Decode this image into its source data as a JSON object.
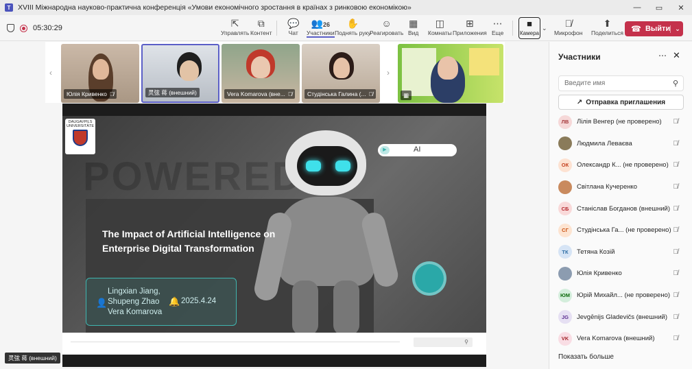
{
  "window": {
    "title": "XVIII Міжнародна науково-практична конференція «Умови економічного зростання в країнах з ринковою економікою»",
    "controls": [
      "—",
      "▭",
      "✕"
    ]
  },
  "toolbar": {
    "timer": "05:30:29",
    "buttons": [
      {
        "label": "Управлять",
        "icon": "control-icon"
      },
      {
        "label": "Контент",
        "icon": "share-content-icon"
      },
      {
        "label": "Чат",
        "icon": "chat-icon"
      },
      {
        "label": "Участники",
        "icon": "people-icon",
        "count": "26"
      },
      {
        "label": "Поднять руку",
        "icon": "raise-hand-icon"
      },
      {
        "label": "Реагировать",
        "icon": "react-icon"
      },
      {
        "label": "Вид",
        "icon": "view-icon"
      },
      {
        "label": "Комнаты",
        "icon": "rooms-icon"
      },
      {
        "label": "Приложения",
        "icon": "apps-icon"
      },
      {
        "label": "Еще",
        "icon": "more-icon"
      },
      {
        "label": "Камера",
        "icon": "camera-icon"
      },
      {
        "label": "Микрофон",
        "icon": "mic-off-icon"
      },
      {
        "label": "Поделиться",
        "icon": "share-icon"
      }
    ],
    "leave_label": "Выйти"
  },
  "video_tiles": [
    {
      "name": "Юлія Кривенко"
    },
    {
      "name": "灵弦 蒋 (внешний)"
    },
    {
      "name": "Vera Komarova (вне..."
    },
    {
      "name": "Студінська Галина (..."
    },
    {
      "name": ""
    }
  ],
  "slide": {
    "watermark": "POWERED",
    "logo_text": "DAUGAVPILS UNIVERSITĀTE",
    "ai_pill": "AI",
    "title": "The Impact of Artificial Intelligence on Enterprise Digital Transformation",
    "authors": [
      "Lingxian Jiang,",
      "Shupeng Zhao",
      "Vera Komarova"
    ],
    "date": "2025.4.24"
  },
  "self_view_name": "灵弦 蒋 (внешний)",
  "panel": {
    "title": "Участники",
    "search_placeholder": "Введите имя",
    "invite_label": "Отправка приглашения",
    "participants": [
      {
        "initials": "ЛВ",
        "name": "Лілія Венгер (не проверено)",
        "bg": "#f6d8d8",
        "fg": "#a4373a"
      },
      {
        "initials": "",
        "name": "Людмила Леваєва",
        "bg": "#8a7b5a",
        "fg": "#fff"
      },
      {
        "initials": "ОК",
        "name": "Олександр К...  (не проверено)",
        "bg": "#fde2d2",
        "fg": "#c43e1c"
      },
      {
        "initials": "",
        "name": "Світлана Кучеренко",
        "bg": "#c98a5e",
        "fg": "#fff"
      },
      {
        "initials": "СБ",
        "name": "Станіслав Богданов (внешний)",
        "bg": "#f9d9d9",
        "fg": "#b4262c"
      },
      {
        "initials": "СГ",
        "name": "Студінська Га...  (не проверено)",
        "bg": "#fde4d1",
        "fg": "#ca5010"
      },
      {
        "initials": "ТК",
        "name": "Тетяна Козій",
        "bg": "#d6e4f5",
        "fg": "#2f6ea5"
      },
      {
        "initials": "",
        "name": "Юлія Кривенко",
        "bg": "#8c9cb0",
        "fg": "#fff"
      },
      {
        "initials": "ЮМ",
        "name": "Юрій Михайл...  (не проверено)",
        "bg": "#d4eedc",
        "fg": "#0b6a0b"
      },
      {
        "initials": "JG",
        "name": "Jevgēnijs Gladevičs (внешний)",
        "bg": "#e6e0f3",
        "fg": "#5c2e91"
      },
      {
        "initials": "VK",
        "name": "Vera Komarova (внешний)",
        "bg": "#f9dde4",
        "fg": "#a4262c"
      }
    ],
    "show_more": "Показать больше"
  }
}
